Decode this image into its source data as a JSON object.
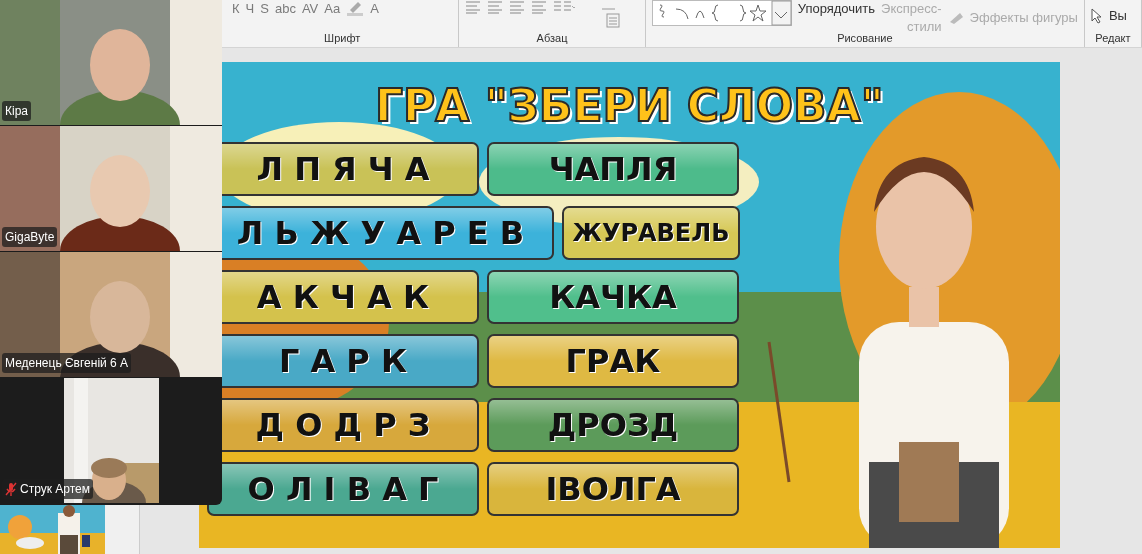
{
  "ribbon": {
    "groups": [
      {
        "label": "Шрифт",
        "tools": [
          {
            "kind": "glyph",
            "label": "К"
          },
          {
            "kind": "glyph",
            "label": "Ч"
          },
          {
            "kind": "glyph",
            "label": "S"
          },
          {
            "kind": "glyph",
            "label": "abc"
          },
          {
            "kind": "glyph",
            "label": "AV"
          },
          {
            "kind": "glyph",
            "label": "Aa"
          },
          {
            "kind": "highlight"
          },
          {
            "kind": "glyph",
            "label": "A"
          }
        ]
      },
      {
        "label": "Абзац",
        "tools": [
          {
            "kind": "align"
          },
          {
            "kind": "align"
          },
          {
            "kind": "align"
          },
          {
            "kind": "align"
          },
          {
            "kind": "columns"
          },
          {
            "kind": "textbox"
          }
        ]
      },
      {
        "label": "Рисование",
        "tools": [
          {
            "kind": "shapes"
          },
          {
            "kind": "text",
            "label": "Упорядочить"
          },
          {
            "kind": "stacked",
            "label": "Экспресс-",
            "label2": "стили"
          },
          {
            "kind": "effects",
            "label": "Эффекты фигуры"
          }
        ]
      },
      {
        "label": "Редакт",
        "tools": [
          {
            "kind": "select",
            "label": "Вы"
          }
        ]
      }
    ]
  },
  "participants": [
    {
      "name": "Кіра",
      "muted": false,
      "kind": "full"
    },
    {
      "name": "GigaByte",
      "muted": false,
      "kind": "full"
    },
    {
      "name": "Меденець Євгеній 6 А",
      "muted": false,
      "kind": "full"
    },
    {
      "name": "Струк Артем",
      "muted": true,
      "kind": "portrait"
    }
  ],
  "slide": {
    "title": "ГРА \"ЗБЕРИ СЛОВА\"",
    "rows": [
      {
        "scrambled": {
          "text": "Л П Я Ч А",
          "color": "#c9c257"
        },
        "answer": {
          "text": "ЧАПЛЯ",
          "color": "#4dbb8b"
        }
      },
      {
        "scrambled": {
          "text": "Л Ь Ж У А Р Е В",
          "color": "#3cb2da"
        },
        "answer": {
          "text": "ЖУРАВЕЛЬ",
          "color": "#d6c855"
        }
      },
      {
        "scrambled": {
          "text": "А К Ч А К",
          "color": "#d4c24c"
        },
        "answer": {
          "text": "КАЧКА",
          "color": "#50bf8c"
        }
      },
      {
        "scrambled": {
          "text": "Г А Р К",
          "color": "#49a9c6"
        },
        "answer": {
          "text": "ГРАК",
          "color": "#dfb943"
        }
      },
      {
        "scrambled": {
          "text": "Д О Д Р З",
          "color": "#d7a83c"
        },
        "answer": {
          "text": "ДРОЗД",
          "color": "#5c9b5a"
        }
      },
      {
        "scrambled": {
          "text": "О Л І В А Г",
          "color": "#4ba891"
        },
        "answer": {
          "text": "ІВОЛГА",
          "color": "#d9b53c"
        }
      }
    ]
  }
}
